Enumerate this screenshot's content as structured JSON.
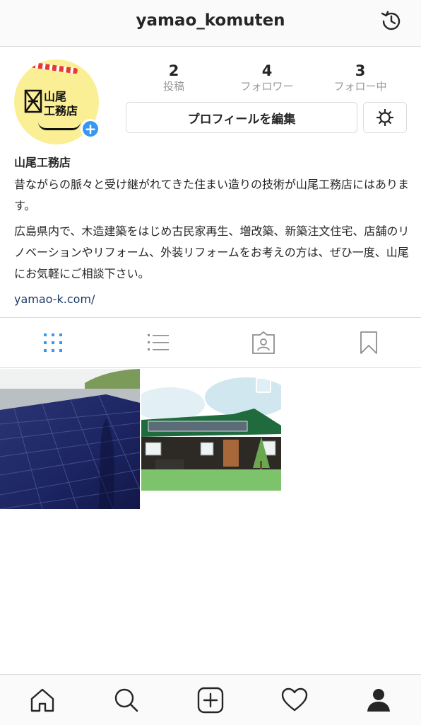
{
  "header": {
    "username": "yamao_komuten",
    "history_icon": "history-icon"
  },
  "profile": {
    "avatar_logo_text": "山尾\n工務店",
    "stats": [
      {
        "value": "2",
        "label": "投稿"
      },
      {
        "value": "4",
        "label": "フォロワー"
      },
      {
        "value": "3",
        "label": "フォロー中"
      }
    ],
    "edit_button_label": "プロフィールを編集",
    "settings_icon": "gear-icon"
  },
  "bio": {
    "name": "山尾工務店",
    "line1": "昔ながらの脈々と受け継がれてきた住まい造りの技術が山尾工務店にはあります。",
    "line2": "広島県内で、木造建築をはじめ古民家再生、増改築、新築注文住宅、店舗のリノベーションやリフォーム、外装リフォームをお考えの方は、ぜひ一度、山尾にお気軽にご相談下さい。",
    "link": "yamao-k.com/"
  },
  "tabs": [
    {
      "name": "grid",
      "icon": "grid-icon",
      "active": true
    },
    {
      "name": "list",
      "icon": "list-icon",
      "active": false
    },
    {
      "name": "tagged",
      "icon": "tagged-person-icon",
      "active": false
    },
    {
      "name": "saved",
      "icon": "bookmark-icon",
      "active": false
    }
  ],
  "posts": [
    {
      "description": "solar-panels-roof-photo"
    },
    {
      "description": "house-illustration-with-solar-roof",
      "multi": true
    }
  ],
  "bottom_nav": [
    {
      "icon": "home-icon"
    },
    {
      "icon": "search-icon"
    },
    {
      "icon": "add-post-icon"
    },
    {
      "icon": "heart-icon"
    },
    {
      "icon": "profile-icon",
      "active": true
    }
  ],
  "colors": {
    "accent": "#3897f0",
    "link": "#1d3a68",
    "border": "#dbdbdb",
    "muted": "#999999"
  }
}
